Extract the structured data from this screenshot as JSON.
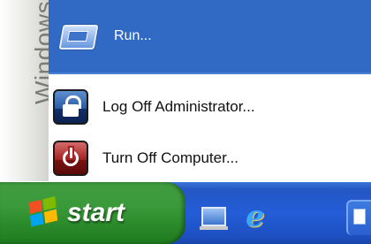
{
  "side_banner": {
    "text": "Windows"
  },
  "menu": {
    "items": [
      {
        "label": "Run...",
        "icon": "run-icon"
      },
      {
        "label": "Log Off Administrator...",
        "icon": "lock-icon"
      },
      {
        "label": "Turn Off Computer...",
        "icon": "power-icon"
      }
    ]
  },
  "taskbar": {
    "start_label": "start",
    "quick_launch": [
      "show-desktop-icon",
      "internet-explorer-icon"
    ]
  },
  "colors": {
    "selection": "#316ac5",
    "start_green": "#3a9a3a",
    "taskbar_blue": "#245dd8"
  }
}
